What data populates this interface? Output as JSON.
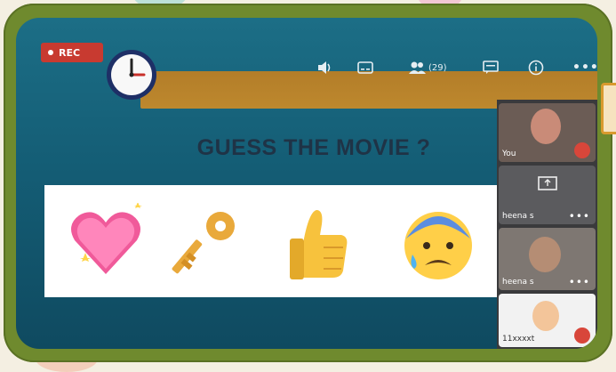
{
  "recording": {
    "label": "REC"
  },
  "toolbar": {
    "participants_count": "(29)"
  },
  "slide": {
    "title": "GUESS THE MOVIE ?"
  },
  "participants": [
    {
      "name": "You"
    },
    {
      "name": "heena s"
    },
    {
      "name": "heena s"
    },
    {
      "name": "11xxxxt"
    }
  ],
  "icons": [
    "clock-icon",
    "volume-icon",
    "captions-icon",
    "people-icon",
    "chat-icon",
    "info-icon",
    "more-icon",
    "heart-emoji",
    "key-emoji",
    "thumbs-up-emoji",
    "anxious-face-emoji",
    "present-icon",
    "mic-off-icon"
  ],
  "colors": {
    "frame": "#6f8a2e",
    "screen": "#1c6e86",
    "rec": "#c83a30",
    "accent_band": "#d08c25"
  }
}
